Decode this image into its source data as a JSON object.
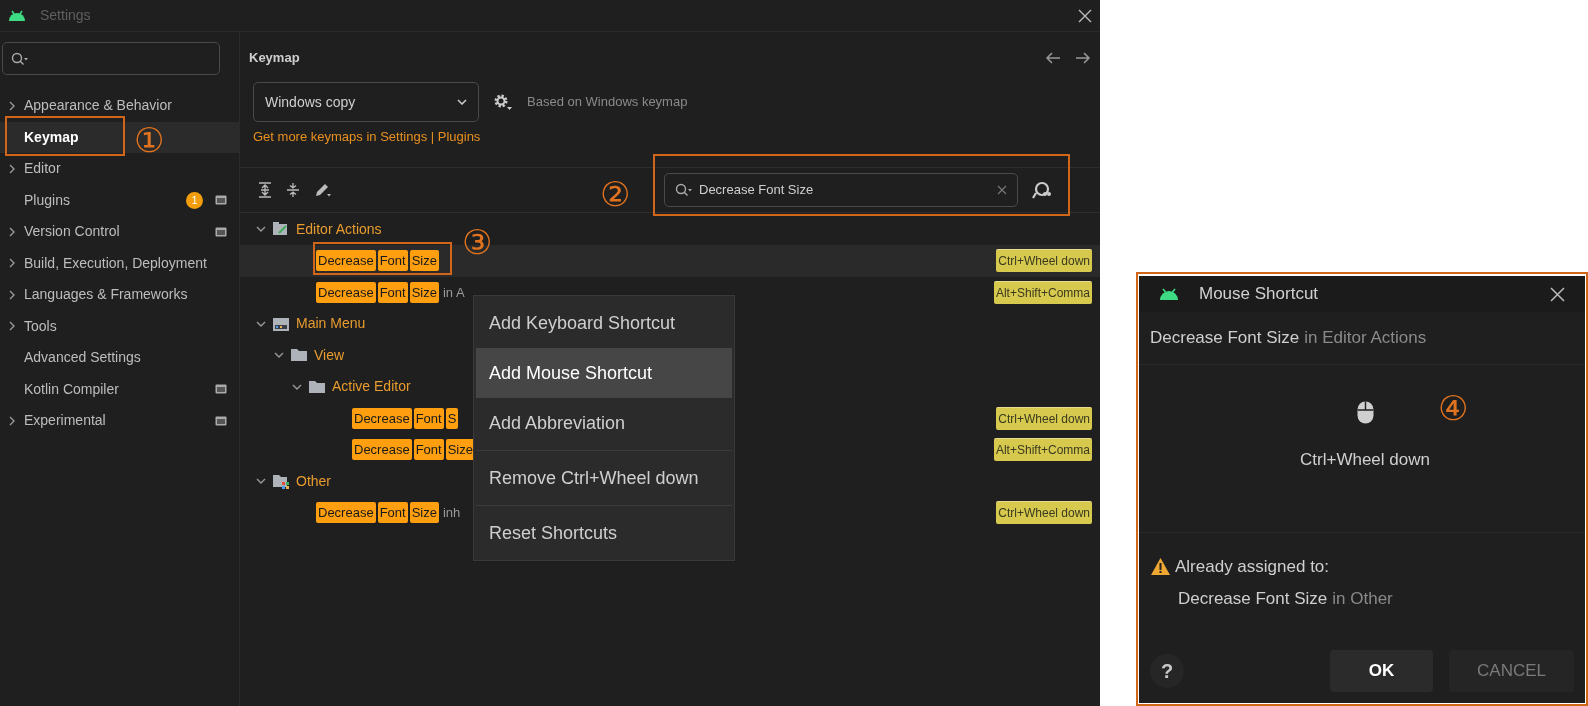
{
  "window": {
    "title": "Settings"
  },
  "sidebar": {
    "items": [
      {
        "label": "Appearance & Behavior",
        "expandable": true,
        "selected": false
      },
      {
        "label": "Keymap",
        "expandable": false,
        "selected": true
      },
      {
        "label": "Editor",
        "expandable": true,
        "selected": false
      },
      {
        "label": "Plugins",
        "expandable": false,
        "selected": false,
        "badge": "1",
        "project_icon": true
      },
      {
        "label": "Version Control",
        "expandable": true,
        "selected": false,
        "project_icon": true
      },
      {
        "label": "Build, Execution, Deployment",
        "expandable": true,
        "selected": false
      },
      {
        "label": "Languages & Frameworks",
        "expandable": true,
        "selected": false
      },
      {
        "label": "Tools",
        "expandable": true,
        "selected": false
      },
      {
        "label": "Advanced Settings",
        "expandable": false,
        "selected": false
      },
      {
        "label": "Kotlin Compiler",
        "expandable": false,
        "selected": false,
        "project_icon": true
      },
      {
        "label": "Experimental",
        "expandable": true,
        "selected": false,
        "project_icon": true
      }
    ]
  },
  "keymap": {
    "title": "Keymap",
    "scheme": "Windows copy",
    "based_on": "Based on Windows keymap",
    "link": "Get more keymaps in Settings | Plugins",
    "search": {
      "value": "Decrease Font Size"
    }
  },
  "tree": [
    {
      "kind": "actions-group",
      "label": "Editor Actions",
      "expanded": true,
      "children": [
        {
          "kind": "action",
          "words": [
            "Decrease",
            "Font",
            "Size"
          ],
          "shortcut": "Ctrl+Wheel down",
          "selected": true
        },
        {
          "kind": "action",
          "words": [
            "Decrease",
            "Font",
            "Size"
          ],
          "suffix": "in A",
          "shortcut": "Alt+Shift+Comma",
          "selected": false
        }
      ]
    },
    {
      "kind": "menu-group",
      "label": "Main Menu",
      "expanded": true,
      "children": [
        {
          "kind": "folder",
          "label": "View",
          "expanded": true,
          "children": [
            {
              "kind": "folder",
              "label": "Active Editor",
              "expanded": true,
              "children": [
                {
                  "kind": "action",
                  "words": [
                    "Decrease",
                    "Font",
                    "S"
                  ],
                  "shortcut": "Ctrl+Wheel down",
                  "selected": false
                },
                {
                  "kind": "action",
                  "words": [
                    "Decrease",
                    "Font",
                    "Size"
                  ],
                  "shortcut": "Alt+Shift+Comma",
                  "selected": false
                }
              ]
            }
          ]
        }
      ]
    },
    {
      "kind": "other-group",
      "label": "Other",
      "expanded": true,
      "children": [
        {
          "kind": "action",
          "words": [
            "Decrease",
            "Font",
            "Size"
          ],
          "suffix": "inh",
          "shortcut": "Ctrl+Wheel down",
          "selected": false
        }
      ]
    }
  ],
  "context_menu": [
    {
      "label": "Add Keyboard Shortcut",
      "selected": false,
      "separator_before": false
    },
    {
      "label": "Add Mouse Shortcut",
      "selected": true,
      "separator_before": false
    },
    {
      "label": "Add Abbreviation",
      "selected": false,
      "separator_before": false
    },
    {
      "label": "Remove Ctrl+Wheel down",
      "selected": false,
      "separator_before": true
    },
    {
      "label": "Reset Shortcuts",
      "selected": false,
      "separator_before": true
    }
  ],
  "dialog": {
    "title": "Mouse Shortcut",
    "action": "Decrease Font Size",
    "context": "in Editor Actions",
    "shortcut": "Ctrl+Wheel down",
    "warning": "Already assigned to:",
    "conflict_action": "Decrease Font Size",
    "conflict_context": "in Other",
    "help": "?",
    "buttons": [
      {
        "label": "OK",
        "default": true
      },
      {
        "label": "CANCEL",
        "default": false
      }
    ]
  },
  "annotations": [
    {
      "label": "①"
    },
    {
      "label": "②"
    },
    {
      "label": "③"
    },
    {
      "label": "④"
    }
  ]
}
